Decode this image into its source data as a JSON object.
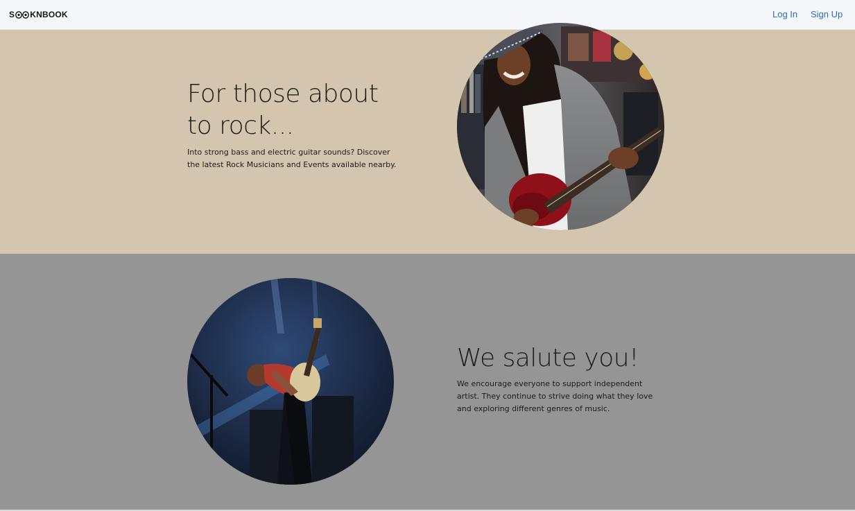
{
  "nav": {
    "brand_prefix": "S",
    "brand_suffix": "KNBOOK",
    "login_label": "Log In",
    "signup_label": "Sign Up"
  },
  "hero": {
    "title": "For those about to rock...",
    "text": "Into strong bass and electric guitar sounds? Discover the latest Rock Musicians and Events available nearby."
  },
  "salute": {
    "title": "We salute you!",
    "text": "We encourage everyone to support independent artist. They continue to strive doing what they love and exploring different genres of music."
  },
  "colors": {
    "navbar_bg": "#f5f7fb",
    "link": "#2a6bc4",
    "hero_bg": "#d4c5ae",
    "salute_bg": "#959595"
  }
}
